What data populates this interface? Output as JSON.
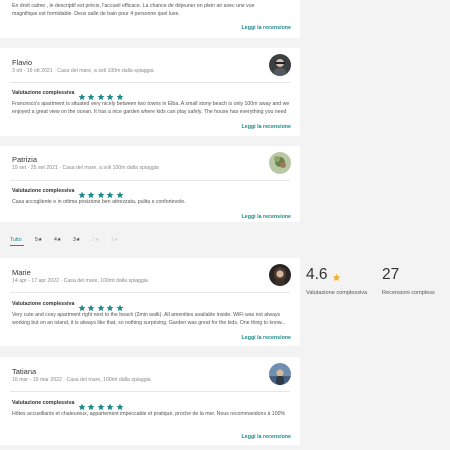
{
  "colors": {
    "accent": "#1f8a8a",
    "star": "#1f8a8a",
    "summary_star": "#f2b01e"
  },
  "reviews_top": {
    "text": "En droit calme , le descriptif est précis, l'accueil efficace. La chance de déjeuner en plein air avec une vue magnifique est formidable. Deux salle de bain pour 4 personne quel luxe.",
    "more_label": "Leggi la recensione"
  },
  "reviews_a": [
    {
      "name": "Flavio",
      "meta": "3 ott - 16 ott 2021 · Casa del mare, a soli 100m dalla spiaggia",
      "rating_label": "Valutazione complessiva",
      "stars": 5,
      "text": "Francesco's apartment is situated very nicely between two towns in Elba. A small stony beach is only 100m away and we enjoyed a great view on the ocean. It has a nice garden where kids can play safely. The house has everything you need for a relaxing holiday.",
      "more_label": "Leggi la recensione"
    },
    {
      "name": "Patrizia",
      "meta": "19 set - 25 set 2021 · Casa del mare, a soli 100m dalla spiaggia",
      "rating_label": "Valutazione complessiva",
      "stars": 5,
      "text": "Casa accogliente e in ottima posizione ben attrezzata, pulita e confortevole.",
      "more_label": "Leggi la recensione"
    }
  ],
  "tabs": [
    "Tutto",
    "5★",
    "4★",
    "3★",
    "2★",
    "1★"
  ],
  "summary": {
    "score": "4.6",
    "score_label": "Valutazione complessiva",
    "count": "27",
    "count_label": "Recensioni compless"
  },
  "reviews_b": [
    {
      "name": "Marie",
      "meta": "14 apr - 17 apr 2022 · Casa del mare, 100mt dalla spiaggia",
      "rating_label": "Valutazione complessiva",
      "stars": 5,
      "text": "Very cute and cosy apartment right next to the beach (2min walk). All amenities available inside. WiFi was not always working but on an island, it is always like that, so nothing surprising. Garden was great for the kids. One thing to know...",
      "more_label": "Leggi la recensione"
    },
    {
      "name": "Tatiana",
      "meta": "16 mar - 19 mar 2022 · Casa del mare, 100mt dalla spiaggia",
      "rating_label": "Valutazione complessiva",
      "stars": 5,
      "text": "Hôtes accueillants et chaleureux, appartement impeccable et pratique, proche de la mer. Nous recommandons à 100%",
      "more_label": "Leggi la recensione"
    }
  ]
}
